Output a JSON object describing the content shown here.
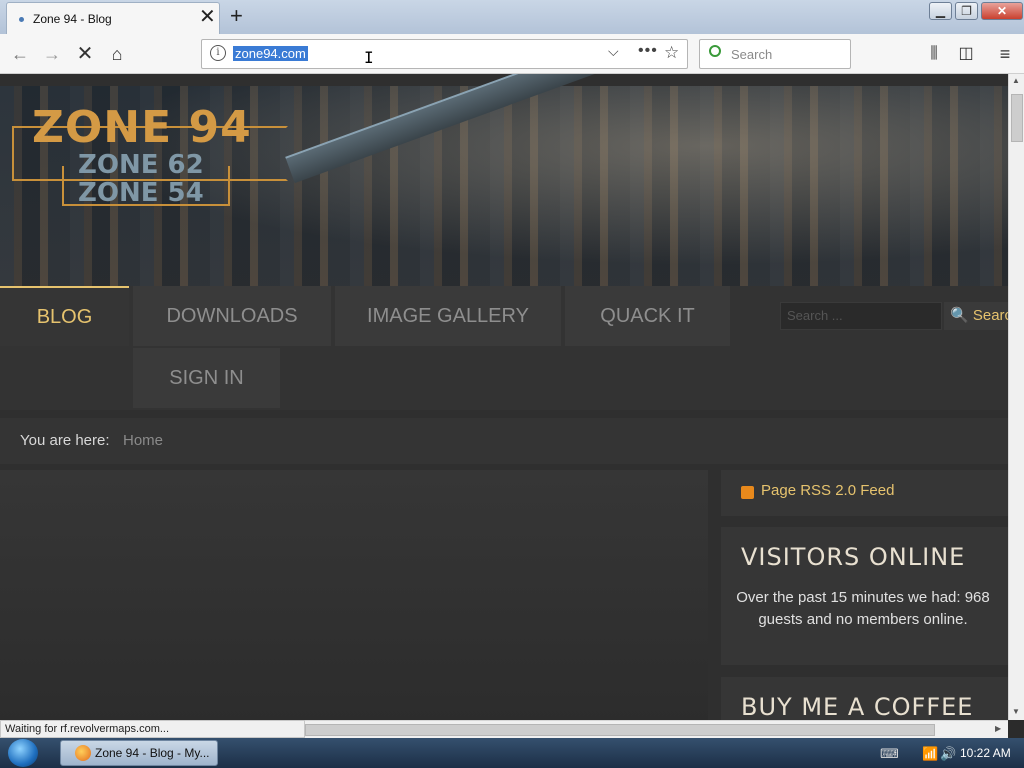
{
  "browser": {
    "tab_title": "Zone 94 - Blog",
    "tab_close": "✕",
    "new_tab": "+",
    "url": "zone94.com",
    "search_placeholder": "Search",
    "icons": [
      "back-arrow-icon",
      "forward-arrow-icon",
      "stop-icon",
      "home-icon",
      "info-icon",
      "chevron-down-icon",
      "more-dots-icon",
      "bookmark-star-icon",
      "library-icon",
      "sidebar-icon",
      "menu-icon"
    ]
  },
  "window_controls": {
    "minimize": "▁",
    "maximize": "❐",
    "close": "✕"
  },
  "site": {
    "logo_main": "ZONE 94",
    "logo_sub1": "ZONE 62",
    "logo_sub2": "ZONE 54",
    "menu": {
      "blog": "BLOG",
      "downloads": "DOWNLOADS",
      "gallery": "IMAGE GALLERY",
      "quack": "QUACK IT",
      "signin": "SIGN IN"
    },
    "search_placeholder": "Search ...",
    "search_button": "Search",
    "breadcrumb_label": "You are here:",
    "breadcrumb_home": "Home",
    "rss_text": "Page RSS 2.0 Feed",
    "visitors_title": "VISITORS ONLINE",
    "visitors_text": "Over the past 15 minutes we had: 968 guests and no members online.",
    "coffee_title": "BUY ME A COFFEE",
    "accent_color": "#e6c36e"
  },
  "status_bar": {
    "text": "Waiting for rf.revolvermaps.com..."
  },
  "taskbar": {
    "task_label": "Zone 94 - Blog - My...",
    "clock": "10:22 AM"
  }
}
